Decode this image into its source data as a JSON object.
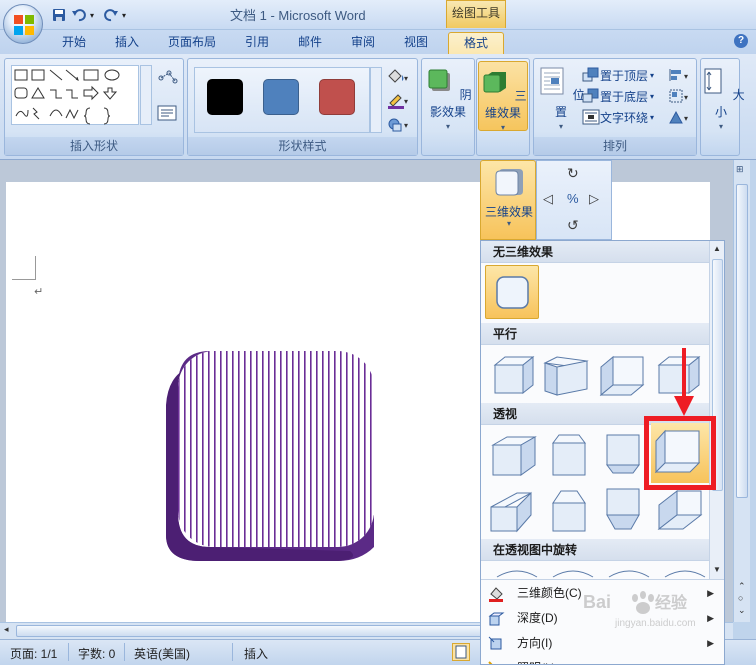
{
  "window": {
    "title": "文档 1 - Microsoft Word",
    "context_tab_group": "绘图工具"
  },
  "tabs": [
    "开始",
    "插入",
    "页面布局",
    "引用",
    "邮件",
    "审阅",
    "视图",
    "格式"
  ],
  "active_tab": "格式",
  "ribbon": {
    "insert_shapes": {
      "label": "插入形状"
    },
    "shape_styles": {
      "label": "形状样式",
      "swatch_colors": [
        "#000000",
        "#4f81bd",
        "#c0504d"
      ]
    },
    "shadow_effects": {
      "label": "阴影效果"
    },
    "three_d_effects": {
      "label": "三维效果"
    },
    "arrange": {
      "label": "排列",
      "position": "位置",
      "bring_to_front": "置于顶层",
      "send_to_back": "置于底层",
      "text_wrapping": "文字环绕"
    },
    "size": {
      "label": "大小"
    }
  },
  "dropdown": {
    "button_label": "三维效果",
    "sections": {
      "none": "无三维效果",
      "parallel": "平行",
      "perspective": "透视",
      "rotate_in_perspective": "在透视图中旋转"
    },
    "menu": [
      {
        "label": "三维颜色(C)",
        "icon": "paint-bucket-icon"
      },
      {
        "label": "深度(D)",
        "icon": "depth-icon"
      },
      {
        "label": "方向(I)",
        "icon": "direction-icon"
      },
      {
        "label": "照明(L)",
        "icon": "lighting-icon"
      }
    ]
  },
  "status": {
    "page": "页面: 1/1",
    "words": "字数: 0",
    "language": "英语(美国)",
    "mode": "插入"
  },
  "document": {
    "shape_fill_color": "#5b2a86",
    "shape_stripe_color": "#6a2d96"
  },
  "watermark": {
    "brand": "Baidu经验",
    "url": "jingyan.baidu.com"
  },
  "highlight_color": "#ee1c24"
}
